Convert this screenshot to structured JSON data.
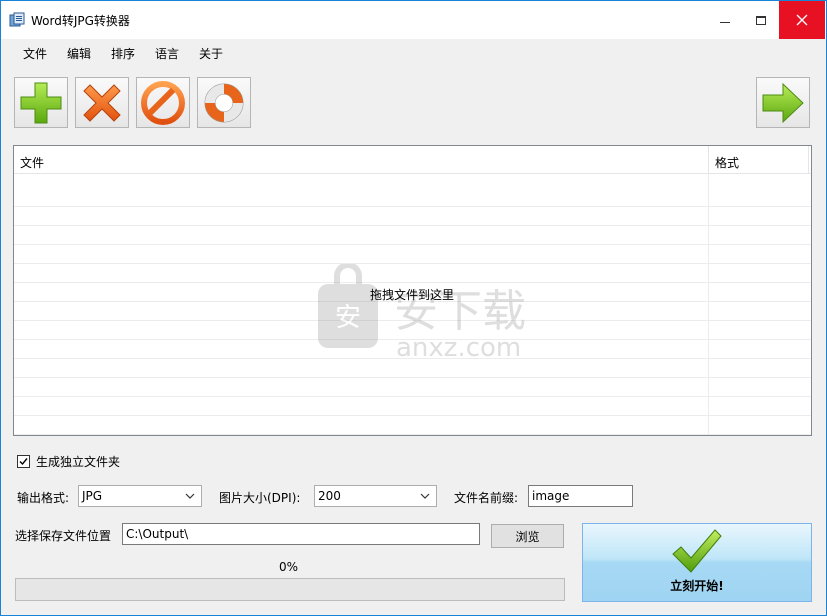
{
  "window": {
    "title": "Word转JPG转换器"
  },
  "menu": {
    "items": [
      "文件",
      "编辑",
      "排序",
      "语言",
      "关于"
    ]
  },
  "toolbar": {
    "add_icon": "plus-icon",
    "remove_icon": "x-icon",
    "clear_icon": "prohibit-icon",
    "help_icon": "lifebuoy-icon",
    "next_icon": "arrow-right-icon"
  },
  "file_list": {
    "columns": [
      "文件",
      "格式"
    ],
    "rows": [],
    "drop_hint": "拖拽文件到这里"
  },
  "options": {
    "separate_folder_label": "生成独立文件夹",
    "separate_folder_checked": true,
    "output_format_label": "输出格式:",
    "output_format_value": "JPG",
    "dpi_label": "图片大小(DPI):",
    "dpi_value": "200",
    "prefix_label": "文件名前缀:",
    "prefix_value": "image",
    "save_location_label": "选择保存文件位置",
    "save_location_value": "C:\\Output\\",
    "browse_label": "浏览"
  },
  "progress": {
    "text": "0%",
    "value": 0
  },
  "start": {
    "label": "立刻开始!"
  },
  "colors": {
    "accent": "#1883d7",
    "close": "#e81123",
    "add": "#7cc520",
    "remove": "#ee6a1d",
    "next": "#7dc623"
  }
}
